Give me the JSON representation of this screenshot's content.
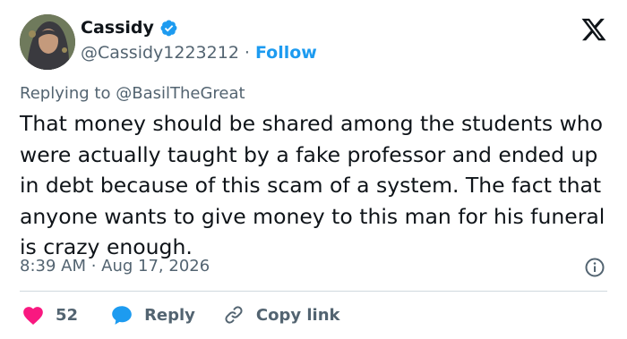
{
  "author": {
    "display_name": "Cassidy",
    "handle": "@Cassidy1223212",
    "separator": "·",
    "follow_label": "Follow",
    "verified": true
  },
  "reply_context": {
    "prefix": "Replying to",
    "mention": "@BasilTheGreat"
  },
  "tweet": {
    "text": "That money should be shared among the students who were actually taught by a fake professor and ended up in debt because of this scam of a system. The fact that anyone wants to give money to this man for his funeral is crazy enough.",
    "timestamp": "8:39 AM · Aug 17, 2026"
  },
  "actions": {
    "like_count": "52",
    "reply_label": "Reply",
    "copy_link_label": "Copy link"
  },
  "colors": {
    "accent": "#1d9bf0",
    "text": "#0f1419",
    "muted": "#536471",
    "like": "#f91880",
    "divider": "#cfd9de"
  },
  "icons": [
    "verified-badge-icon",
    "x-logo-icon",
    "info-icon",
    "heart-icon",
    "reply-bubble-icon",
    "link-icon"
  ]
}
